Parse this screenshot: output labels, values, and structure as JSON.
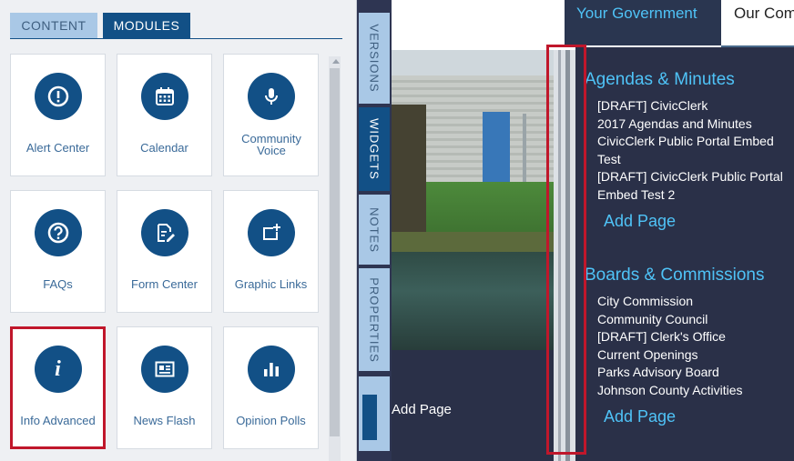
{
  "left_panel": {
    "tabs": [
      {
        "label": "CONTENT"
      },
      {
        "label": "MODULES"
      }
    ],
    "tiles": [
      {
        "label": "Alert Center",
        "icon": "alert-icon"
      },
      {
        "label": "Calendar",
        "icon": "calendar-icon"
      },
      {
        "label": "Community Voice",
        "icon": "microphone-icon"
      },
      {
        "label": "FAQs",
        "icon": "question-icon"
      },
      {
        "label": "Form Center",
        "icon": "form-edit-icon"
      },
      {
        "label": "Graphic Links",
        "icon": "graphic-link-icon"
      },
      {
        "label": "Info Advanced",
        "icon": "info-icon"
      },
      {
        "label": "News Flash",
        "icon": "newspaper-icon"
      },
      {
        "label": "Opinion Polls",
        "icon": "bar-chart-icon"
      }
    ]
  },
  "side_tabs": [
    {
      "label": "VERSIONS"
    },
    {
      "label": "WIDGETS"
    },
    {
      "label": "NOTES"
    },
    {
      "label": "PROPERTIES"
    }
  ],
  "preview": {
    "nav": {
      "your_government": "Your Government",
      "our_community": "Our Community"
    },
    "left_add_page": "Add Page",
    "agendas": {
      "title": "Agendas & Minutes",
      "links": [
        "[DRAFT] CivicClerk",
        "2017 Agendas and Minutes",
        "CivicClerk Public Portal Embed Test",
        "[DRAFT] CivicClerk Public Portal Embed Test 2"
      ],
      "add_page": "Add Page"
    },
    "boards": {
      "title": "Boards & Commissions",
      "links": [
        "City Commission",
        "Community Council",
        "[DRAFT] Clerk's Office",
        "Current Openings",
        "Parks Advisory Board",
        "Johnson County Activities"
      ],
      "add_page": "Add Page"
    }
  },
  "colors": {
    "accent": "#125086",
    "highlight": "#c0172b",
    "link": "#4fc3f7",
    "dark": "#2a3048"
  }
}
